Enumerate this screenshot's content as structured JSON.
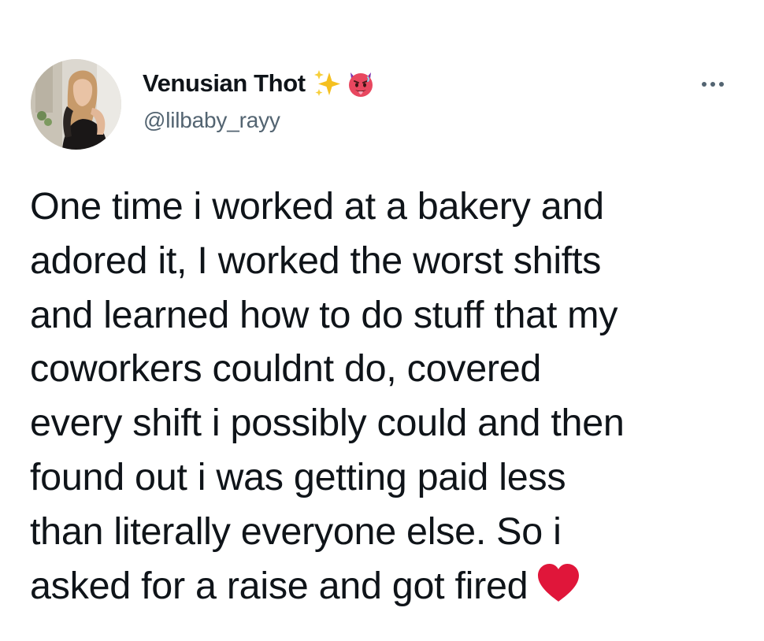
{
  "tweet": {
    "author": {
      "display_name": "Venusian Thot",
      "handle": "@lilbaby_rayy",
      "name_emojis": [
        "sparkles-icon",
        "hot-face-devil-icon"
      ],
      "avatar": "profile-photo"
    },
    "more_menu_icon": "more-horizontal-icon",
    "text_lines": [
      "One time i worked at a bakery and",
      "adored it, I worked the worst shifts",
      "and learned how to do stuff that my",
      "coworkers couldnt do, covered",
      "every shift i possibly could and then",
      "found out i was getting paid less",
      "than literally everyone else. So i",
      "asked for a raise and got fired"
    ],
    "trailing_emoji": "red-heart-icon"
  },
  "colors": {
    "text": "#0f1419",
    "secondary_text": "#536471",
    "heart": "#e0163a",
    "sparkles": "#f5c020",
    "devil_face": "#e8475f"
  }
}
